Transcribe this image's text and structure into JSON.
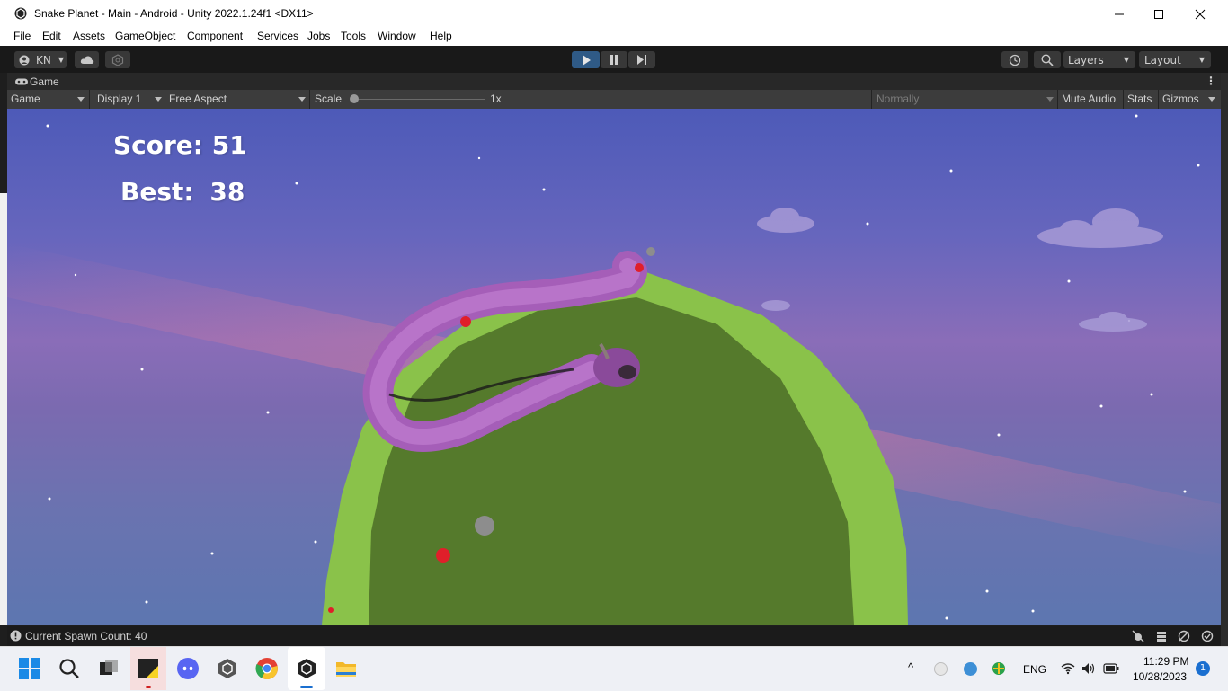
{
  "window": {
    "title": "Snake Planet - Main - Android - Unity 2022.1.24f1 <DX11>"
  },
  "menu": [
    "File",
    "Edit",
    "Assets",
    "GameObject",
    "Component",
    "Services",
    "Jobs",
    "Tools",
    "Window",
    "Help"
  ],
  "toolbar": {
    "account": "KN",
    "layers": "Layers",
    "layout": "Layout"
  },
  "tab": {
    "label": "Game"
  },
  "gamebar": {
    "mode": "Game",
    "display": "Display 1",
    "aspect": "Free Aspect",
    "scale_label": "Scale",
    "scale_value": "1x",
    "play_focus": "Normally",
    "mute": "Mute Audio",
    "stats": "Stats",
    "gizmos": "Gizmos"
  },
  "hud": {
    "score_label": "Score:",
    "score_value": "51",
    "best_label": "Best:",
    "best_value": "38"
  },
  "status": {
    "text": "Current Spawn Count: 40"
  },
  "taskbar": {
    "lang": "ENG",
    "time": "11:29 PM",
    "date": "10/28/2023",
    "notif_count": "1"
  },
  "colors": {
    "planet_outer": "#8ac24a",
    "planet_inner": "#557a2c",
    "snake": "#b06ac0",
    "sky_top": "#4d5ab8",
    "play_active": "#2f5a86"
  }
}
